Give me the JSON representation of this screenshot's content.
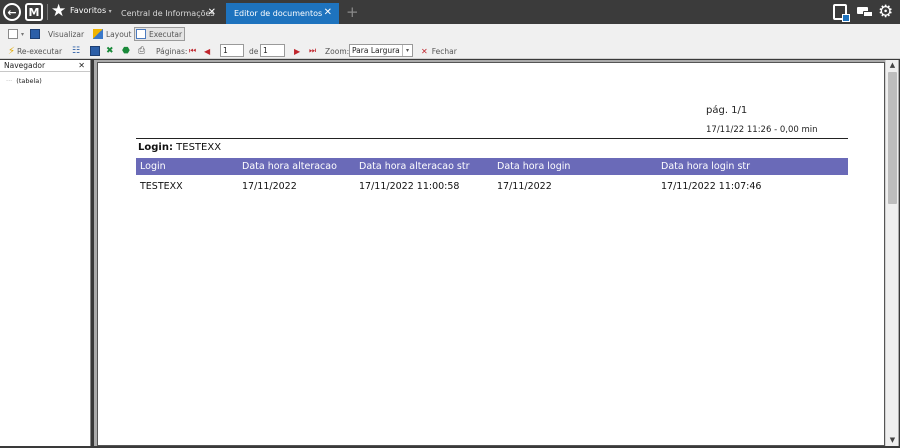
{
  "topbar": {
    "favorites_label": "Favoritos",
    "favorites_caret": "▾",
    "tabs": [
      {
        "label": "Central de Informações",
        "close": "✕"
      },
      {
        "label": "Editor de documentos",
        "close": "✕"
      }
    ],
    "new_tab": "+"
  },
  "toolbar": {
    "row1": {
      "visualizar": "Visualizar",
      "layout": "Layout",
      "executar": "Executar"
    },
    "row2": {
      "reexecutar": "Re-executar",
      "paginas_label": "Páginas:",
      "page_current": "1",
      "de_label": "de",
      "page_total": "1",
      "zoom_label": "Zoom:",
      "zoom_value": "Para Largura",
      "fechar": "Fechar"
    }
  },
  "navigator": {
    "title": "Navegador",
    "close": "✕",
    "items": [
      {
        "label": "(tabela)"
      }
    ]
  },
  "report": {
    "page_label": "pág. 1/1",
    "generated": "17/11/22 11:26 - 0,00 min",
    "login_label": "Login:",
    "login_value": "TESTEXX",
    "columns": [
      "Login",
      "Data hora alteracao",
      "Data hora alteracao str",
      "Data hora login",
      "Data hora login str"
    ],
    "rows": [
      [
        "TESTEXX",
        "17/11/2022",
        "17/11/2022 11:00:58",
        "17/11/2022",
        "17/11/2022 11:07:46"
      ]
    ]
  },
  "colors": {
    "topbar_bg": "#3b3b3b",
    "active_tab": "#1e73be",
    "table_header": "#6a6ab8"
  }
}
